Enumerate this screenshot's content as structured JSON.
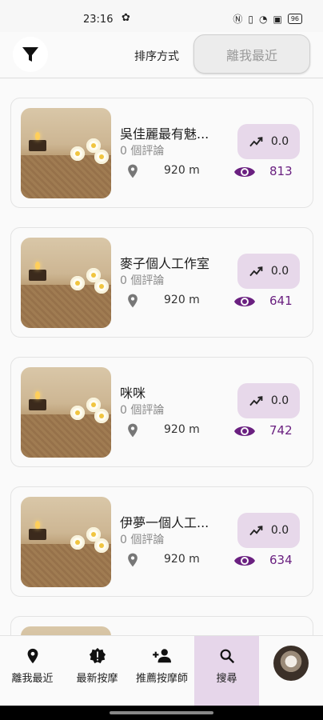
{
  "status_bar": {
    "time": "23:16",
    "battery": "96"
  },
  "header": {
    "sort_label": "排序方式",
    "sort_value": "離我最近"
  },
  "cards": [
    {
      "title": "吳佳麗最有魅...",
      "reviews": "0 個評論",
      "distance": "920 m",
      "rating": "0.0",
      "views": "813"
    },
    {
      "title": "麥子個人工作室",
      "reviews": "0 個評論",
      "distance": "920 m",
      "rating": "0.0",
      "views": "641"
    },
    {
      "title": "咪咪",
      "reviews": "0 個評論",
      "distance": "920 m",
      "rating": "0.0",
      "views": "742"
    },
    {
      "title": "伊夢一個人工...",
      "reviews": "0 個評論",
      "distance": "920 m",
      "rating": "0.0",
      "views": "634"
    }
  ],
  "bottom_nav": {
    "items": [
      {
        "label": "離我最近",
        "icon": "location-pin-icon"
      },
      {
        "label": "最新按摩",
        "icon": "new-badge-icon"
      },
      {
        "label": "推薦按摩師",
        "icon": "add-person-icon"
      },
      {
        "label": "搜尋",
        "icon": "search-icon"
      }
    ],
    "active_index": 3
  },
  "colors": {
    "accent": "#6a2080",
    "chip_bg": "#e7d8ea",
    "active_nav_bg": "#e6d6ea"
  }
}
